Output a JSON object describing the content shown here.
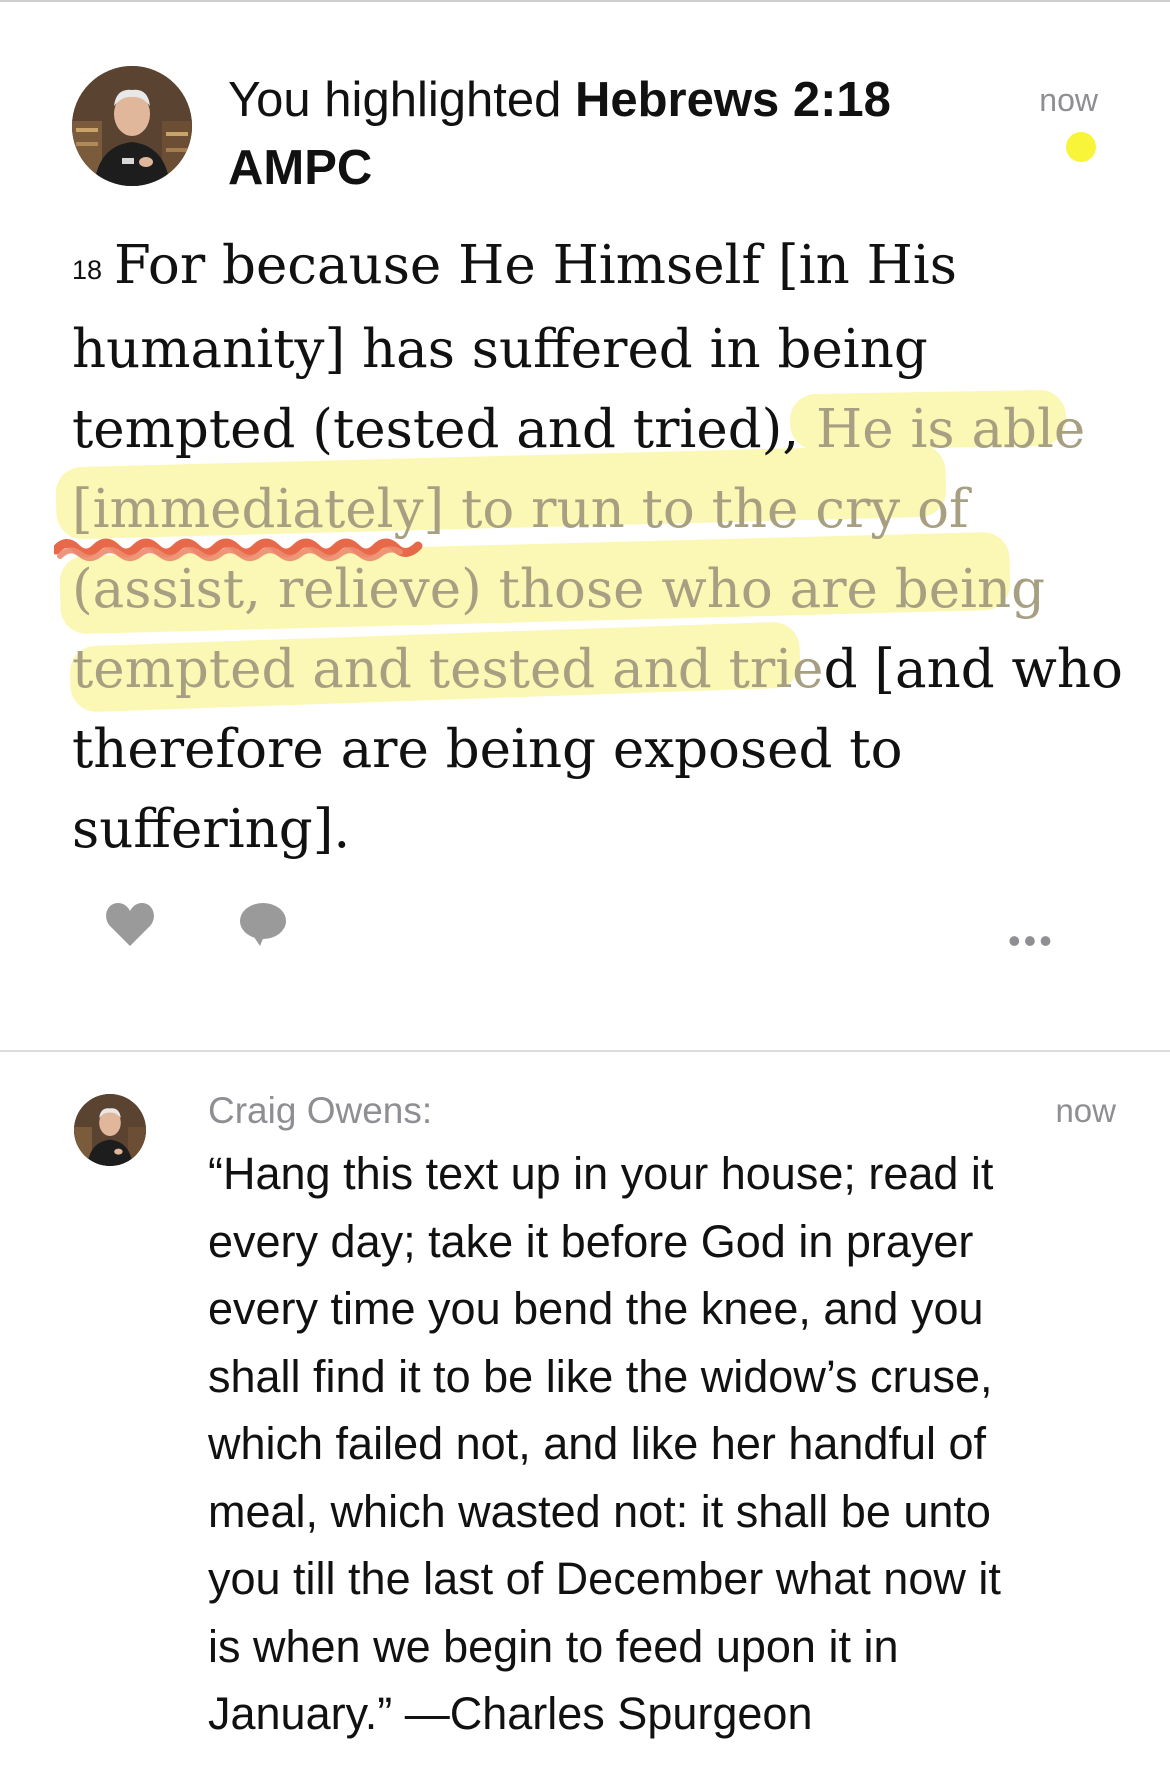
{
  "activity": {
    "headline_prefix": "You highlighted",
    "reference_line1": "Hebrews 2:18",
    "reference_line2": "AMPC",
    "timestamp": "now",
    "highlight_color": "#f7f43a"
  },
  "verse": {
    "number": "18",
    "lines": [
      "For because He Himself [in His",
      "humanity] has suffered in being",
      "tempted (tested and tried), ",
      "He is able",
      "[immediately] to run to the cry of",
      "(assist, relieve) those who are being",
      "tempted and tested and trie",
      "d [and who",
      "therefore are being exposed to",
      "suffering]."
    ]
  },
  "actions": {
    "like_icon": "heart-icon",
    "comment_icon": "comment-bubble-icon",
    "more_icon": "more-options-icon",
    "more_label": "•••"
  },
  "comment": {
    "author": "Craig Owens:",
    "timestamp": "now",
    "lines": [
      "“Hang this text up in your house; read it",
      "every day; take it before God in prayer",
      "every time you bend the knee, and you",
      "shall find it to be like the widow’s cruse,",
      "which failed not, and like her handful of",
      "meal, which wasted not: it shall be unto",
      "you till the last of December what now it",
      "is when we begin to feed upon it in",
      "January.” —Charles Spurgeon"
    ]
  },
  "colors": {
    "marker_yellow": "#fbf7b4",
    "underline_red": "#e8684a",
    "muted_gray": "#8e8e93"
  }
}
